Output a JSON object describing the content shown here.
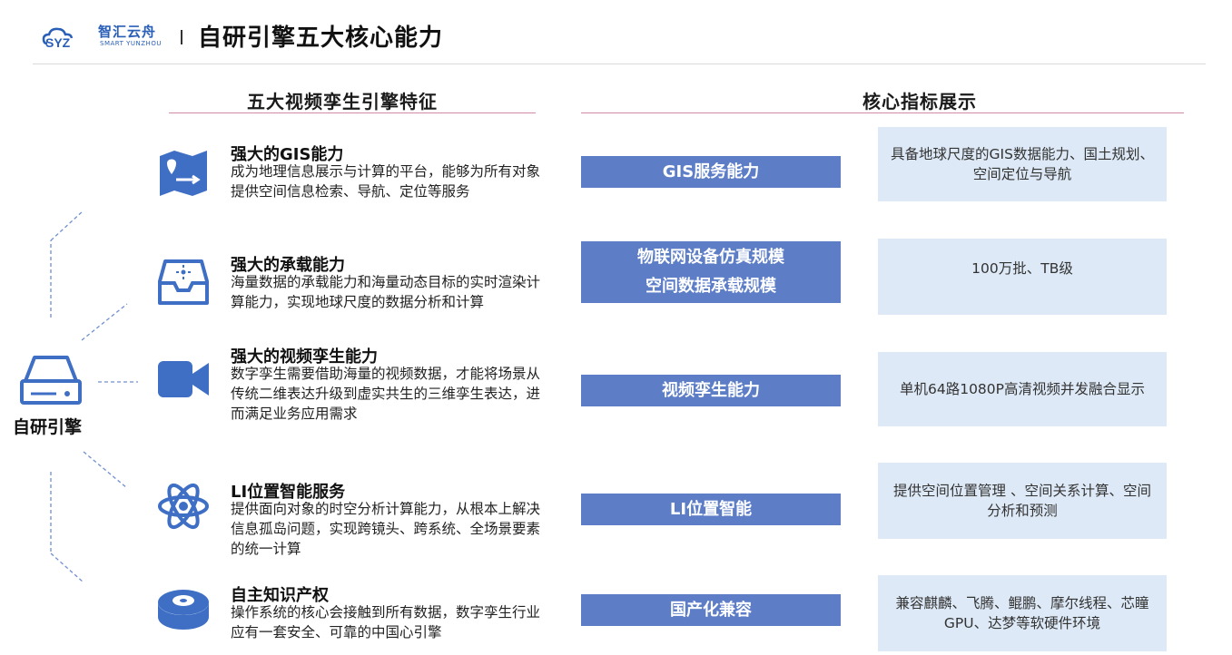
{
  "header": {
    "logo_mark": "SYZ",
    "logo_cn": "智汇云舟",
    "logo_en": "SMART YUNZHOU",
    "title": "自研引擎五大核心能力"
  },
  "left_section": {
    "title": "五大视频孪生引擎特征"
  },
  "right_section": {
    "title": "核心指标展示"
  },
  "engine": {
    "label": "自研引擎"
  },
  "features": [
    {
      "icon": "map-icon",
      "title": "强大的GIS能力",
      "desc": "成为地理信息展示与计算的平台，能够为所有对象提供空间信息检索、导航、定位等服务"
    },
    {
      "icon": "inbox-icon",
      "title": "强大的承载能力",
      "desc": "海量数据的承载能力和海量动态目标的实时渲染计算能力，实现地球尺度的数据分析和计算"
    },
    {
      "icon": "video-camera-icon",
      "title": "强大的视频孪生能力",
      "desc": "数字孪生需要借助海量的视频数据，才能将场景从传统二维表达升级到虚实共生的三维孪生表达，进而满足业务应用需求"
    },
    {
      "icon": "atom-icon",
      "title": "LI位置智能服务",
      "desc": "提供面向对象的时空分析计算能力，从根本上解决信息孤岛问题，实现跨镜头、跨系统、全场景要素的统一计算"
    },
    {
      "icon": "database-disc-icon",
      "title": "自主知识产权",
      "desc": "操作系统的核心会接触到所有数据，数字孪生行业应有一套安全、可靠的中国心引擎"
    }
  ],
  "metrics": [
    {
      "name_lines": [
        "GIS服务能力"
      ],
      "value": "具备地球尺度的GIS数据能力、国土规划、空间定位与导航"
    },
    {
      "name_lines": [
        "物联网设备仿真规模",
        "空间数据承载规模"
      ],
      "value": "100万批、TB级"
    },
    {
      "name_lines": [
        "视频孪生能力"
      ],
      "value": "单机64路1080P高清视频并发融合显示"
    },
    {
      "name_lines": [
        "LI位置智能"
      ],
      "value": "提供空间位置管理 、空间关系计算、空间分析和预测"
    },
    {
      "name_lines": [
        "国产化兼容"
      ],
      "value": "兼容麒麟、飞腾、鲲鹏、摩尔线程、芯瞳GPU、达梦等软硬件环境"
    }
  ],
  "colors": {
    "accent_blue": "#5d7ec7",
    "light_blue": "#dde9f6",
    "icon_blue": "#3f6fc4",
    "rule_pink": "#d28aa6"
  }
}
